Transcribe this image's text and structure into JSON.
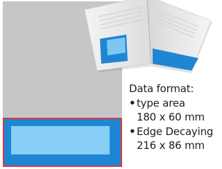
{
  "colors": {
    "page_background": "#c7c6c6",
    "bleed_area_fill": "#1e86d4",
    "type_area_fill": "#87cef4",
    "bleed_area_border": "#e53935",
    "text": "#1e1e1e"
  },
  "icons": {
    "magazine_mockup": "open-magazine-photo"
  },
  "spec": {
    "heading": "Data format:",
    "items": [
      {
        "label": "type area",
        "dimensions": "180 x 60 mm"
      },
      {
        "label": "Edge Decaying",
        "dimensions": "216 x 86 mm"
      }
    ]
  }
}
